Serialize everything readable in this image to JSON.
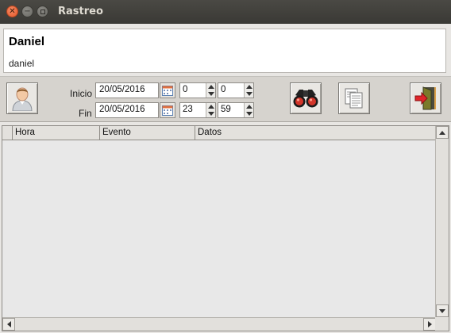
{
  "window": {
    "title": "Rastreo"
  },
  "user": {
    "name": "Daniel",
    "login": "daniel"
  },
  "filters": {
    "start_label": "Inicio",
    "end_label": "Fin",
    "start_date": "20/05/2016",
    "end_date": "20/05/2016",
    "start_hour": "0",
    "start_minute": "0",
    "end_hour": "23",
    "end_minute": "59"
  },
  "table": {
    "columns": [
      "Hora",
      "Evento",
      "Datos"
    ],
    "rows": []
  },
  "icons": {
    "user_button": "user-avatar-icon",
    "calendar": "calendar-icon",
    "search": "binoculars-icon",
    "copy": "copy-documents-icon",
    "exit": "exit-door-icon"
  },
  "colors": {
    "titlebar": "#3c3b37",
    "close_button": "#e4572a",
    "table_background": "#e8e8e8"
  }
}
